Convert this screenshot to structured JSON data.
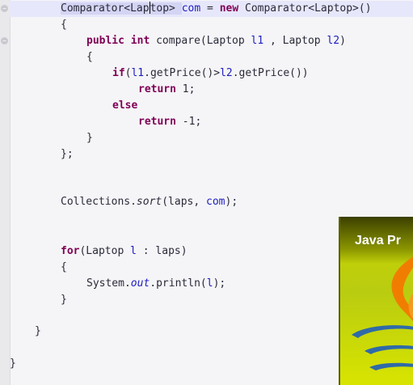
{
  "editor": {
    "lines": {
      "l1_a": "Comparator<Lap",
      "l1_b": "top> ",
      "l1_c": "com",
      "l1_d": " = ",
      "l1_e": "new",
      "l1_f": " Comparator<Laptop>()",
      "l2": "{",
      "l3_a": "public",
      "l3_b": " ",
      "l3_c": "int",
      "l3_d": " compare(Laptop ",
      "l3_e": "l1",
      "l3_f": " , Laptop ",
      "l3_g": "l2",
      "l3_h": ")",
      "l4": "{",
      "l5_a": "if",
      "l5_b": "(",
      "l5_c": "l1",
      "l5_d": ".getPrice()>",
      "l5_e": "l2",
      "l5_f": ".getPrice())",
      "l6_a": "return",
      "l6_b": " 1;",
      "l7": "else",
      "l8_a": "return",
      "l8_b": " -1;",
      "l9": "}",
      "l10": "};",
      "l11_a": "Collections.",
      "l11_b": "sort",
      "l11_c": "(laps, ",
      "l11_d": "com",
      "l11_e": ");",
      "l12_a": "for",
      "l12_b": "(Laptop ",
      "l12_c": "l",
      "l12_d": " : laps)",
      "l13": "{",
      "l14_a": "System.",
      "l14_b": "out",
      "l14_c": ".println(",
      "l14_d": "l",
      "l14_e": ");",
      "l15": "}",
      "l16": "}",
      "l17": "}"
    }
  },
  "overlay": {
    "title": "Java Pr"
  },
  "icons": {
    "fold": "fold-marker-icon",
    "logo": "java-cup-icon"
  },
  "colors": {
    "keyword": "#7f0055",
    "field": "#1c1cbf",
    "text": "#2a2a3a",
    "current_line": "#e7e7fb",
    "logo_bg": "#c9d400",
    "logo_flame": "#f07d00",
    "logo_cup": "#2f6aa8"
  }
}
